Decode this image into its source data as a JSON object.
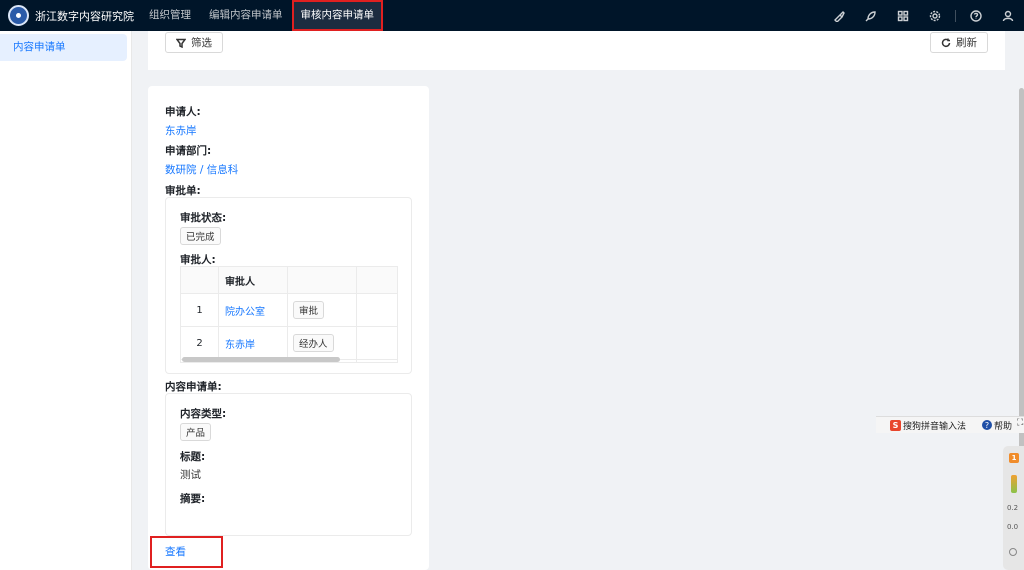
{
  "header": {
    "brand_title": "浙江数字内容研究院",
    "nav": [
      {
        "label": "组织管理"
      },
      {
        "label": "编辑内容申请单"
      },
      {
        "label": "审核内容申请单"
      }
    ]
  },
  "sidebar": {
    "items": [
      {
        "label": "内容申请单"
      }
    ]
  },
  "filter_bar": {
    "filter_label": "筛选",
    "refresh_label": "刷新"
  },
  "detail": {
    "applicant_label": "申请人:",
    "applicant_value": "东赤岸",
    "department_label": "申请部门:",
    "department_value": "数研院 / 信息科",
    "approval_form_label": "审批单:",
    "approval": {
      "status_label": "审批状态:",
      "status_value": "已完成",
      "approvers_label": "审批人:",
      "table": {
        "header": [
          "",
          "审批人",
          ""
        ],
        "rows": [
          {
            "index": "1",
            "approver": "院办公室",
            "role": "审批"
          },
          {
            "index": "2",
            "approver": "东赤岸",
            "role": "经办人"
          }
        ]
      }
    },
    "content_form_label": "内容申请单:",
    "content": {
      "type_label": "内容类型:",
      "type_value": "产品",
      "title_label": "标题:",
      "title_value": "测试",
      "summary_label": "摘要:"
    },
    "view_link": "查看"
  },
  "ime_toolbar": {
    "ime_label": "搜狗拼音输入法",
    "help_label": "帮助"
  },
  "widget": {
    "badge": "1",
    "stat1": "0.2",
    "stat2": "0.0"
  },
  "colors": {
    "topbar_bg": "#001529",
    "accent": "#1677ff",
    "highlight_border": "#e02020"
  }
}
